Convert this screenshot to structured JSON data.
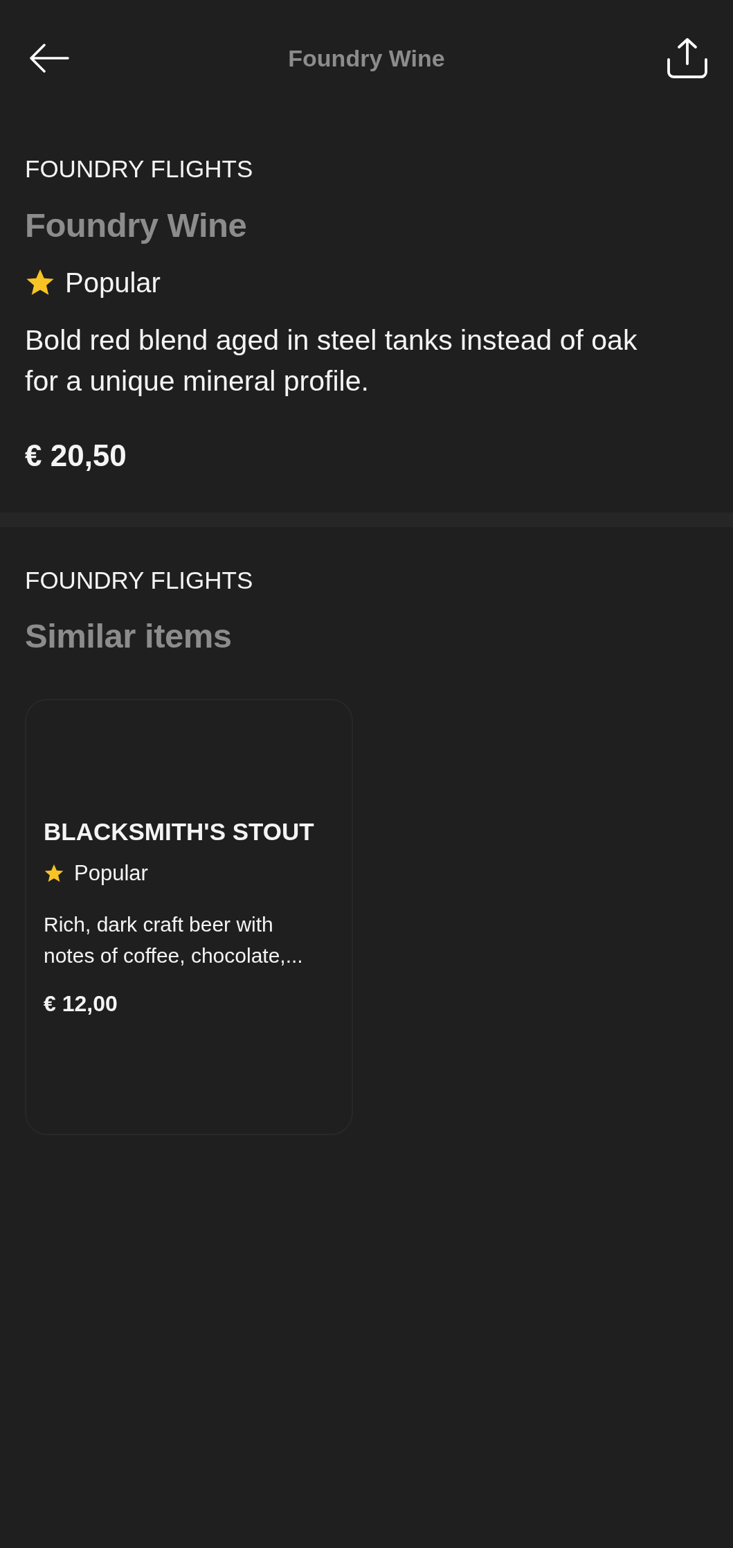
{
  "header": {
    "title": "Foundry Wine"
  },
  "product": {
    "category": "FOUNDRY FLIGHTS",
    "name": "Foundry Wine",
    "badge": "Popular",
    "description": "Bold red blend aged in steel tanks instead of oak for a unique mineral profile.",
    "price": "€ 20,50"
  },
  "similar": {
    "category": "FOUNDRY FLIGHTS",
    "title": "Similar items",
    "items": [
      {
        "name": "BLACKSMITH'S STOUT",
        "badge": "Popular",
        "description": "Rich, dark craft beer with notes of coffee, chocolate,...",
        "price": "€ 12,00"
      }
    ]
  }
}
